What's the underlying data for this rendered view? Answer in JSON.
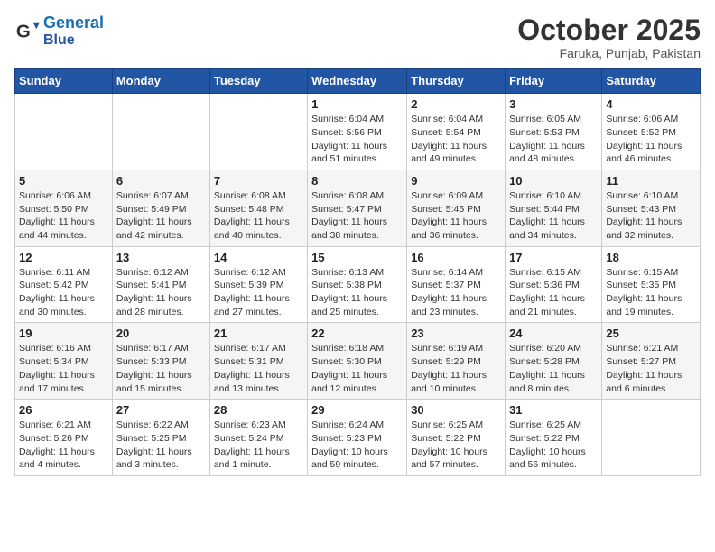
{
  "logo": {
    "line1": "General",
    "line2": "Blue"
  },
  "title": "October 2025",
  "location": "Faruka, Punjab, Pakistan",
  "weekdays": [
    "Sunday",
    "Monday",
    "Tuesday",
    "Wednesday",
    "Thursday",
    "Friday",
    "Saturday"
  ],
  "weeks": [
    [
      {
        "num": "",
        "info": ""
      },
      {
        "num": "",
        "info": ""
      },
      {
        "num": "",
        "info": ""
      },
      {
        "num": "1",
        "info": "Sunrise: 6:04 AM\nSunset: 5:56 PM\nDaylight: 11 hours\nand 51 minutes."
      },
      {
        "num": "2",
        "info": "Sunrise: 6:04 AM\nSunset: 5:54 PM\nDaylight: 11 hours\nand 49 minutes."
      },
      {
        "num": "3",
        "info": "Sunrise: 6:05 AM\nSunset: 5:53 PM\nDaylight: 11 hours\nand 48 minutes."
      },
      {
        "num": "4",
        "info": "Sunrise: 6:06 AM\nSunset: 5:52 PM\nDaylight: 11 hours\nand 46 minutes."
      }
    ],
    [
      {
        "num": "5",
        "info": "Sunrise: 6:06 AM\nSunset: 5:50 PM\nDaylight: 11 hours\nand 44 minutes."
      },
      {
        "num": "6",
        "info": "Sunrise: 6:07 AM\nSunset: 5:49 PM\nDaylight: 11 hours\nand 42 minutes."
      },
      {
        "num": "7",
        "info": "Sunrise: 6:08 AM\nSunset: 5:48 PM\nDaylight: 11 hours\nand 40 minutes."
      },
      {
        "num": "8",
        "info": "Sunrise: 6:08 AM\nSunset: 5:47 PM\nDaylight: 11 hours\nand 38 minutes."
      },
      {
        "num": "9",
        "info": "Sunrise: 6:09 AM\nSunset: 5:45 PM\nDaylight: 11 hours\nand 36 minutes."
      },
      {
        "num": "10",
        "info": "Sunrise: 6:10 AM\nSunset: 5:44 PM\nDaylight: 11 hours\nand 34 minutes."
      },
      {
        "num": "11",
        "info": "Sunrise: 6:10 AM\nSunset: 5:43 PM\nDaylight: 11 hours\nand 32 minutes."
      }
    ],
    [
      {
        "num": "12",
        "info": "Sunrise: 6:11 AM\nSunset: 5:42 PM\nDaylight: 11 hours\nand 30 minutes."
      },
      {
        "num": "13",
        "info": "Sunrise: 6:12 AM\nSunset: 5:41 PM\nDaylight: 11 hours\nand 28 minutes."
      },
      {
        "num": "14",
        "info": "Sunrise: 6:12 AM\nSunset: 5:39 PM\nDaylight: 11 hours\nand 27 minutes."
      },
      {
        "num": "15",
        "info": "Sunrise: 6:13 AM\nSunset: 5:38 PM\nDaylight: 11 hours\nand 25 minutes."
      },
      {
        "num": "16",
        "info": "Sunrise: 6:14 AM\nSunset: 5:37 PM\nDaylight: 11 hours\nand 23 minutes."
      },
      {
        "num": "17",
        "info": "Sunrise: 6:15 AM\nSunset: 5:36 PM\nDaylight: 11 hours\nand 21 minutes."
      },
      {
        "num": "18",
        "info": "Sunrise: 6:15 AM\nSunset: 5:35 PM\nDaylight: 11 hours\nand 19 minutes."
      }
    ],
    [
      {
        "num": "19",
        "info": "Sunrise: 6:16 AM\nSunset: 5:34 PM\nDaylight: 11 hours\nand 17 minutes."
      },
      {
        "num": "20",
        "info": "Sunrise: 6:17 AM\nSunset: 5:33 PM\nDaylight: 11 hours\nand 15 minutes."
      },
      {
        "num": "21",
        "info": "Sunrise: 6:17 AM\nSunset: 5:31 PM\nDaylight: 11 hours\nand 13 minutes."
      },
      {
        "num": "22",
        "info": "Sunrise: 6:18 AM\nSunset: 5:30 PM\nDaylight: 11 hours\nand 12 minutes."
      },
      {
        "num": "23",
        "info": "Sunrise: 6:19 AM\nSunset: 5:29 PM\nDaylight: 11 hours\nand 10 minutes."
      },
      {
        "num": "24",
        "info": "Sunrise: 6:20 AM\nSunset: 5:28 PM\nDaylight: 11 hours\nand 8 minutes."
      },
      {
        "num": "25",
        "info": "Sunrise: 6:21 AM\nSunset: 5:27 PM\nDaylight: 11 hours\nand 6 minutes."
      }
    ],
    [
      {
        "num": "26",
        "info": "Sunrise: 6:21 AM\nSunset: 5:26 PM\nDaylight: 11 hours\nand 4 minutes."
      },
      {
        "num": "27",
        "info": "Sunrise: 6:22 AM\nSunset: 5:25 PM\nDaylight: 11 hours\nand 3 minutes."
      },
      {
        "num": "28",
        "info": "Sunrise: 6:23 AM\nSunset: 5:24 PM\nDaylight: 11 hours\nand 1 minute."
      },
      {
        "num": "29",
        "info": "Sunrise: 6:24 AM\nSunset: 5:23 PM\nDaylight: 10 hours\nand 59 minutes."
      },
      {
        "num": "30",
        "info": "Sunrise: 6:25 AM\nSunset: 5:22 PM\nDaylight: 10 hours\nand 57 minutes."
      },
      {
        "num": "31",
        "info": "Sunrise: 6:25 AM\nSunset: 5:22 PM\nDaylight: 10 hours\nand 56 minutes."
      },
      {
        "num": "",
        "info": ""
      }
    ]
  ]
}
